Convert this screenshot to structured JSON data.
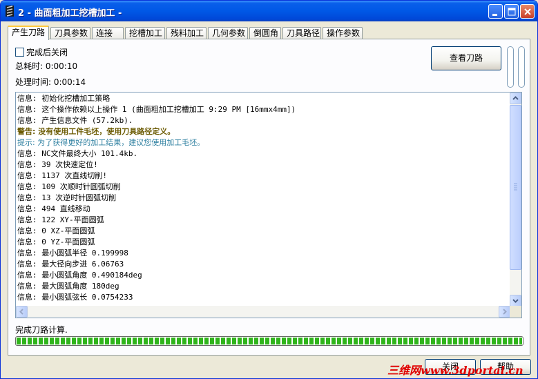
{
  "window": {
    "title": "2 - 曲面粗加工挖槽加工 -"
  },
  "tabs": [
    {
      "label": "产生刀路",
      "active": true
    },
    {
      "label": "刀具参数"
    },
    {
      "label": "连接"
    },
    {
      "label": "挖槽加工"
    },
    {
      "label": "残料加工"
    },
    {
      "label": "几何参数"
    },
    {
      "label": "倒圆角"
    },
    {
      "label": "刀具路径"
    },
    {
      "label": "操作参数"
    }
  ],
  "options": {
    "close_after_complete_label": "完成后关闭",
    "close_after_complete_checked": false
  },
  "timing": {
    "total_label": "总耗时: 0:00:10",
    "processing_label": "处理时间: 0:00:14"
  },
  "buttons": {
    "view_toolpath": "查看刀路",
    "close": "关闭",
    "help": "帮助"
  },
  "log": [
    {
      "text": "信息: 初始化挖槽加工策略",
      "kind": "info"
    },
    {
      "text": "信息: 这个操作依赖以上操作 1 (曲面粗加工挖槽加工 9:29 PM [16mmx4mm])",
      "kind": "info"
    },
    {
      "text": "信息: 产生信息文件 (57.2kb).",
      "kind": "info"
    },
    {
      "text": "警告: 没有使用工件毛坯，使用刀具路径定义。",
      "kind": "warning"
    },
    {
      "text": "提示: 为了获得更好的加工结果，建议您使用加工毛坯。",
      "kind": "hint"
    },
    {
      "text": "信息: NC文件最终大小 101.4kb.",
      "kind": "info"
    },
    {
      "text": "信息: 39 次快速定位!",
      "kind": "info"
    },
    {
      "text": "信息: 1137 次直线切削!",
      "kind": "info"
    },
    {
      "text": "信息: 109 次顺时针圆弧切削",
      "kind": "info"
    },
    {
      "text": "信息: 13 次逆时针圆弧切削",
      "kind": "info"
    },
    {
      "text": "信息: 494 直线移动",
      "kind": "info"
    },
    {
      "text": "信息: 122 XY-平面圆弧",
      "kind": "info"
    },
    {
      "text": "信息: 0 XZ-平面圆弧",
      "kind": "info"
    },
    {
      "text": "信息: 0 YZ-平面圆弧",
      "kind": "info"
    },
    {
      "text": "信息: 最小圆弧半径 0.199998",
      "kind": "info"
    },
    {
      "text": "信息: 最大径向步进 6.06763",
      "kind": "info"
    },
    {
      "text": "信息: 最小圆弧角度 0.490184deg",
      "kind": "info"
    },
    {
      "text": "信息: 最大圆弧角度 180deg",
      "kind": "info"
    },
    {
      "text": "信息: 最小圆弧弦长 0.0754233",
      "kind": "info"
    }
  ],
  "status": {
    "text": "完成刀路计算.",
    "progress": 1.0
  },
  "watermark": "三维网www.3dportal.cn",
  "colors": {
    "titlebar": "#0058E6",
    "progress": "#2FB41B",
    "warning": "#6B5A00",
    "hint": "#2D7FA0"
  }
}
